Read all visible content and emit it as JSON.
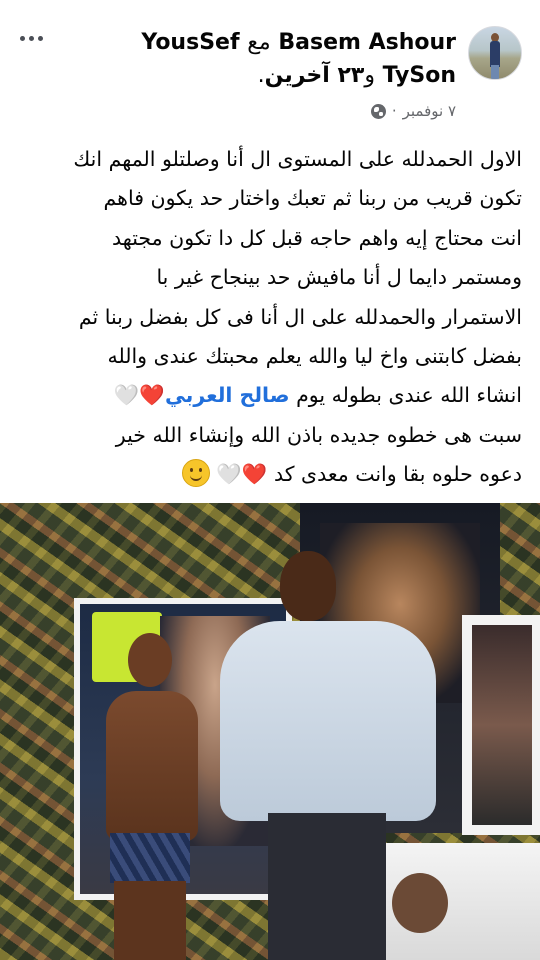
{
  "header": {
    "author": "Basem Ashour",
    "with": "مع",
    "tagged_first": "YousSef",
    "tagged_second": "TySon",
    "and": "و",
    "others": "٢٣ آخرين",
    "period": ".",
    "time": "٧ نوفمبر",
    "separator": "·",
    "privacy_icon": "globe-icon",
    "more_icon": "more-horizontal-icon"
  },
  "post": {
    "lines": [
      "الاول الحمدلله على المستوى ال أنا وصلتلو المهم انك",
      "تكون قريب من ربنا ثم تعبك واختار حد يكون فاهم",
      "انت محتاج إيه واهم حاجه قبل كل دا تكون مجتهد",
      "ومستمر دايما ل أنا مافيش حد بينجاح غير با",
      "الاستمرار والحمدلله على ال أنا فى كل بفضل ربنا ثم",
      "بفضل كابتنى واخ ليا والله يعلم محبتك عندى والله"
    ],
    "mention_line_before": "انشاء الله عندى بطوله يوم",
    "mention": "صالح العربي",
    "emoji_red_heart": "❤️",
    "emoji_white_heart": "🤍",
    "lines_after": [
      "سبت هى خطوه جديده باذن الله وإنشاء الله خير",
      "دعوه حلوه بقا وانت معدى كد"
    ]
  },
  "photo": {
    "description_icon": "post-photo"
  }
}
